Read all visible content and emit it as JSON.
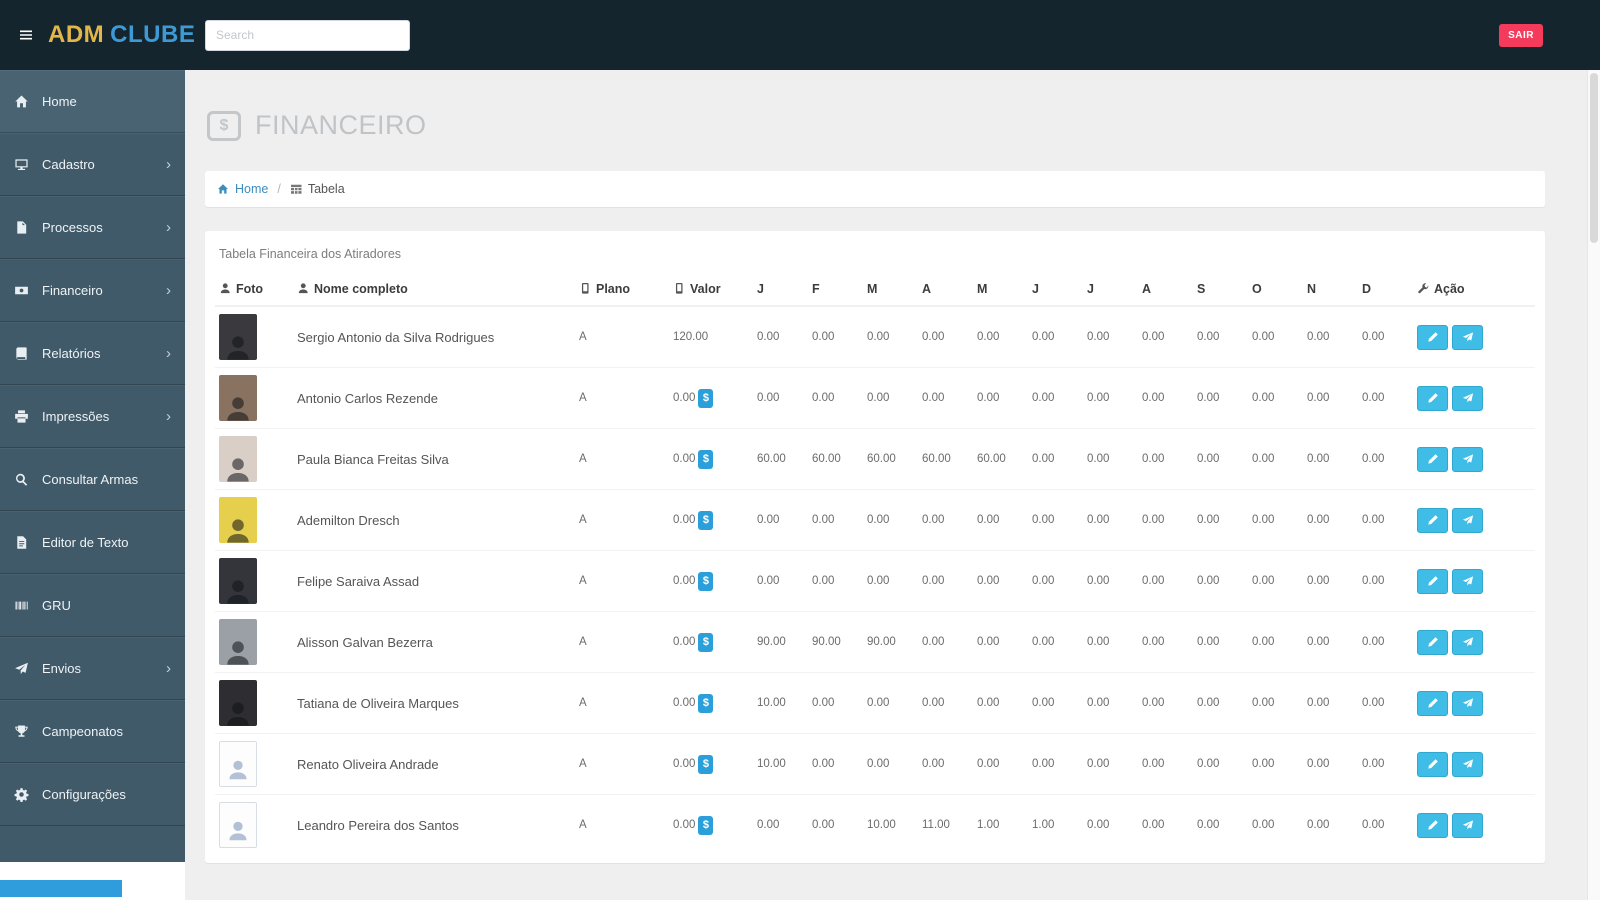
{
  "brand": {
    "prefix": "ADM",
    "suffix": "CLUBE"
  },
  "topbar": {
    "search_placeholder": "Search",
    "logout_label": "SAIR"
  },
  "sidebar": {
    "items": [
      {
        "label": "Home",
        "icon": "home-icon",
        "has_submenu": false,
        "active": true
      },
      {
        "label": "Cadastro",
        "icon": "desktop-icon",
        "has_submenu": true,
        "active": false
      },
      {
        "label": "Processos",
        "icon": "file-icon",
        "has_submenu": true,
        "active": false
      },
      {
        "label": "Financeiro",
        "icon": "money-icon",
        "has_submenu": true,
        "active": false
      },
      {
        "label": "Relatórios",
        "icon": "book-icon",
        "has_submenu": true,
        "active": false
      },
      {
        "label": "Impressões",
        "icon": "printer-icon",
        "has_submenu": true,
        "active": false
      },
      {
        "label": "Consultar Armas",
        "icon": "search-icon",
        "has_submenu": false,
        "active": false
      },
      {
        "label": "Editor de Texto",
        "icon": "doc-text-icon",
        "has_submenu": false,
        "active": false
      },
      {
        "label": "GRU",
        "icon": "barcode-icon",
        "has_submenu": false,
        "active": false
      },
      {
        "label": "Envios",
        "icon": "send-icon",
        "has_submenu": true,
        "active": false
      },
      {
        "label": "Campeonatos",
        "icon": "trophy-icon",
        "has_submenu": false,
        "active": false
      },
      {
        "label": "Configurações",
        "icon": "gear-icon",
        "has_submenu": false,
        "active": false
      }
    ]
  },
  "page": {
    "title": "FINANCEIRO",
    "title_icon_glyph": "$"
  },
  "breadcrumb": {
    "home_label": "Home",
    "separator": "/",
    "current_label": "Tabela"
  },
  "panel": {
    "title": "Tabela Financeira dos Atiradores"
  },
  "table": {
    "columns": {
      "foto": "Foto",
      "nome": "Nome completo",
      "plano": "Plano",
      "valor": "Valor",
      "acao": "Ação"
    },
    "month_headers": [
      "J",
      "F",
      "M",
      "A",
      "M",
      "J",
      "J",
      "A",
      "S",
      "O",
      "N",
      "D"
    ],
    "dollar_badge_glyph": "$",
    "rows": [
      {
        "name": "Sergio Antonio da Silva Rodrigues",
        "plan": "A",
        "value": "120.00",
        "dollar_badge": false,
        "avatar": "photo",
        "avatar_color": "#3a3a3e",
        "months": [
          "0.00",
          "0.00",
          "0.00",
          "0.00",
          "0.00",
          "0.00",
          "0.00",
          "0.00",
          "0.00",
          "0.00",
          "0.00",
          "0.00"
        ]
      },
      {
        "name": "Antonio Carlos Rezende",
        "plan": "A",
        "value": "0.00",
        "dollar_badge": true,
        "avatar": "photo",
        "avatar_color": "#8a7260",
        "months": [
          "0.00",
          "0.00",
          "0.00",
          "0.00",
          "0.00",
          "0.00",
          "0.00",
          "0.00",
          "0.00",
          "0.00",
          "0.00",
          "0.00"
        ]
      },
      {
        "name": "Paula Bianca Freitas Silva",
        "plan": "A",
        "value": "0.00",
        "dollar_badge": true,
        "avatar": "photo",
        "avatar_color": "#d9cfc7",
        "months": [
          "60.00",
          "60.00",
          "60.00",
          "60.00",
          "60.00",
          "0.00",
          "0.00",
          "0.00",
          "0.00",
          "0.00",
          "0.00",
          "0.00"
        ]
      },
      {
        "name": "Ademilton Dresch",
        "plan": "A",
        "value": "0.00",
        "dollar_badge": true,
        "avatar": "photo",
        "avatar_color": "#e5cf4d",
        "months": [
          "0.00",
          "0.00",
          "0.00",
          "0.00",
          "0.00",
          "0.00",
          "0.00",
          "0.00",
          "0.00",
          "0.00",
          "0.00",
          "0.00"
        ]
      },
      {
        "name": "Felipe Saraiva Assad",
        "plan": "A",
        "value": "0.00",
        "dollar_badge": true,
        "avatar": "photo",
        "avatar_color": "#33353b",
        "months": [
          "0.00",
          "0.00",
          "0.00",
          "0.00",
          "0.00",
          "0.00",
          "0.00",
          "0.00",
          "0.00",
          "0.00",
          "0.00",
          "0.00"
        ]
      },
      {
        "name": "Alisson Galvan Bezerra",
        "plan": "A",
        "value": "0.00",
        "dollar_badge": true,
        "avatar": "photo",
        "avatar_color": "#9aa0a6",
        "months": [
          "90.00",
          "90.00",
          "90.00",
          "0.00",
          "0.00",
          "0.00",
          "0.00",
          "0.00",
          "0.00",
          "0.00",
          "0.00",
          "0.00"
        ]
      },
      {
        "name": "Tatiana de Oliveira Marques",
        "plan": "A",
        "value": "0.00",
        "dollar_badge": true,
        "avatar": "photo",
        "avatar_color": "#2e2e32",
        "months": [
          "10.00",
          "0.00",
          "0.00",
          "0.00",
          "0.00",
          "0.00",
          "0.00",
          "0.00",
          "0.00",
          "0.00",
          "0.00",
          "0.00"
        ]
      },
      {
        "name": "Renato Oliveira Andrade",
        "plan": "A",
        "value": "0.00",
        "dollar_badge": true,
        "avatar": "placeholder",
        "avatar_color": "",
        "months": [
          "10.00",
          "0.00",
          "0.00",
          "0.00",
          "0.00",
          "0.00",
          "0.00",
          "0.00",
          "0.00",
          "0.00",
          "0.00",
          "0.00"
        ]
      },
      {
        "name": "Leandro Pereira dos Santos",
        "plan": "A",
        "value": "0.00",
        "dollar_badge": true,
        "avatar": "placeholder",
        "avatar_color": "",
        "months": [
          "0.00",
          "0.00",
          "10.00",
          "11.00",
          "1.00",
          "1.00",
          "0.00",
          "0.00",
          "0.00",
          "0.00",
          "0.00",
          "0.00"
        ]
      }
    ]
  }
}
